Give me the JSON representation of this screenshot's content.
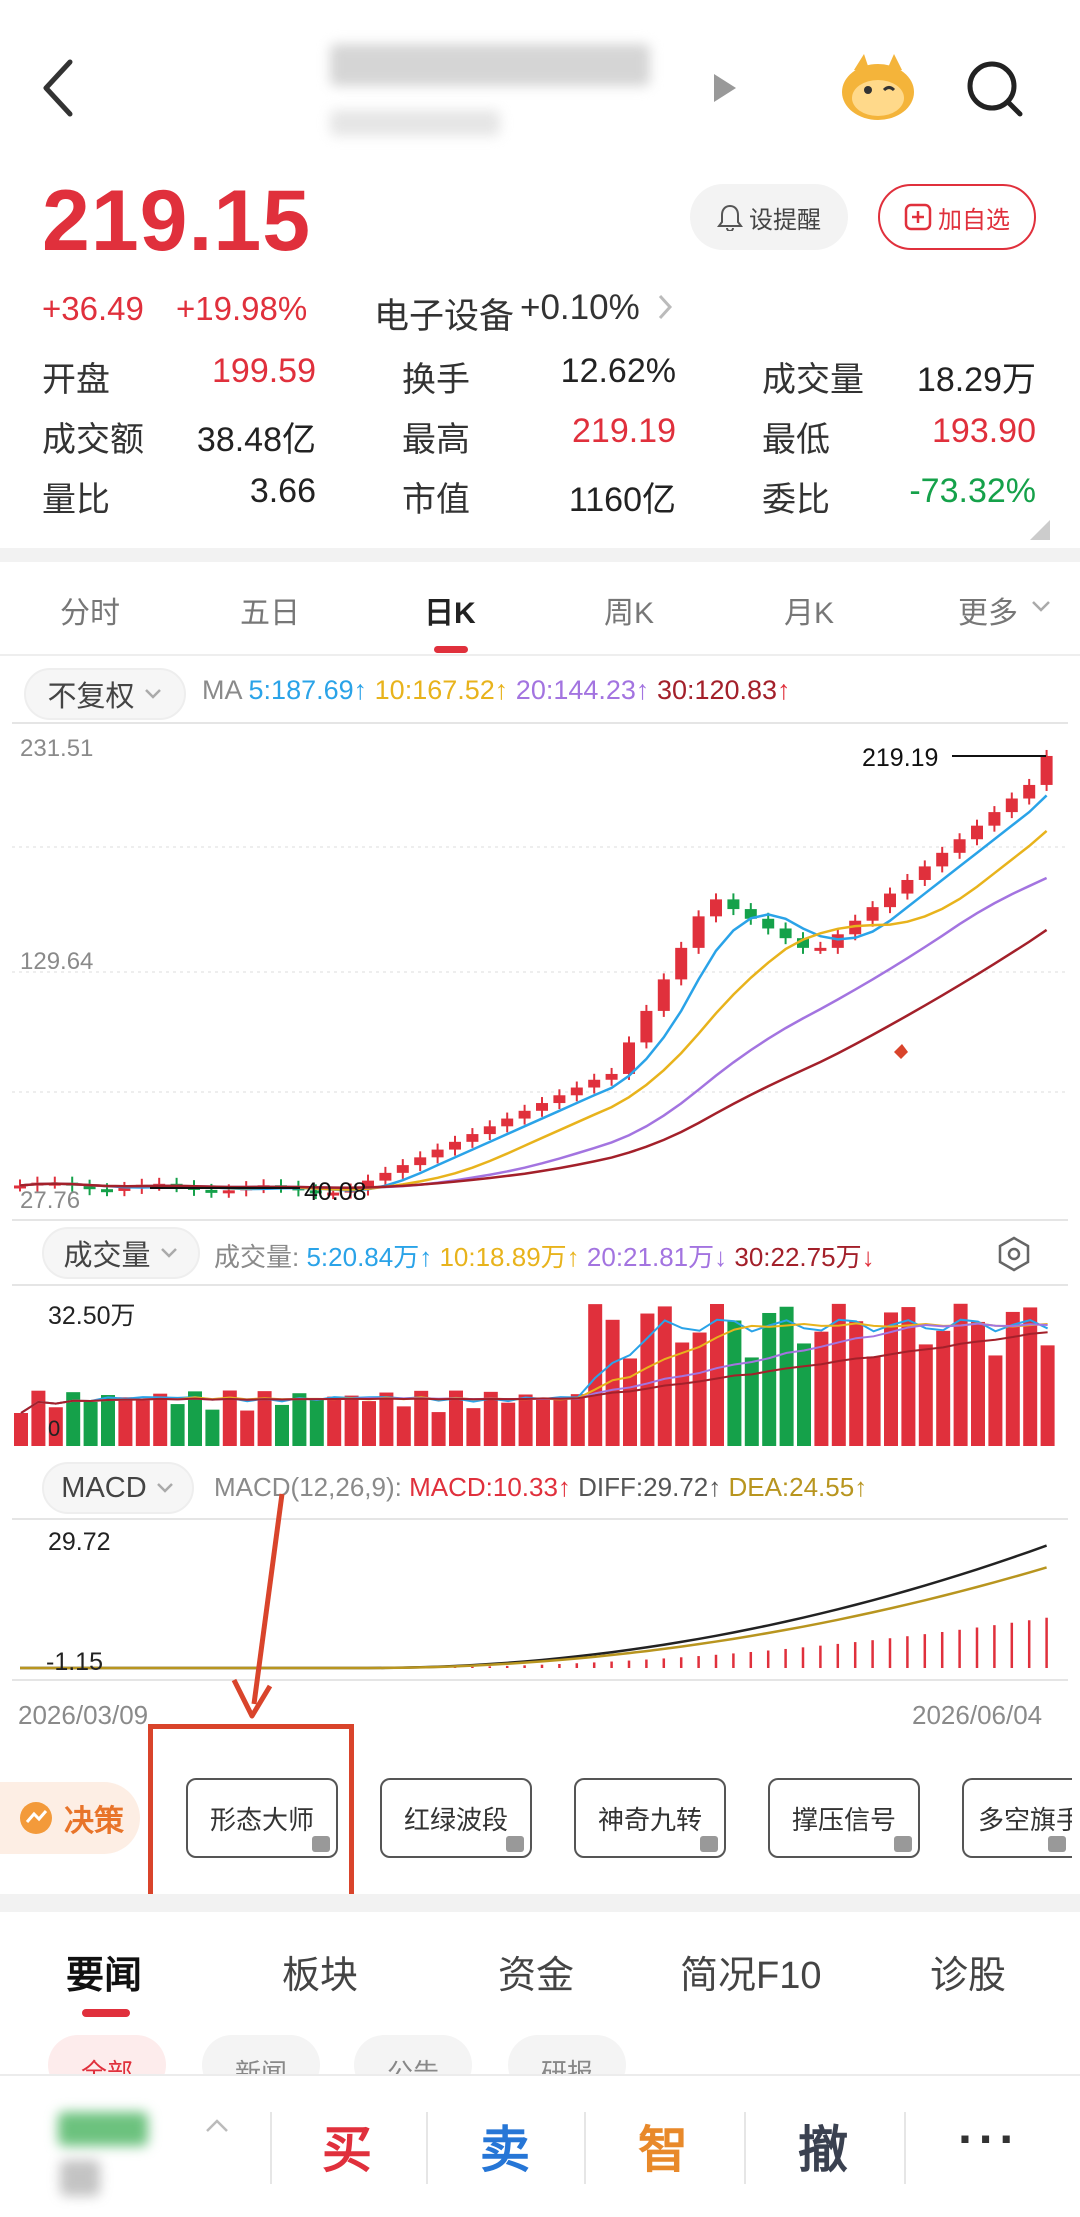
{
  "header": {
    "back_icon": "chevron-left-icon",
    "next_icon": "triangle-right-icon",
    "mascot_icon": "mascot-icon",
    "search_icon": "search-icon"
  },
  "quote": {
    "price": "219.15",
    "change": "+36.49",
    "change_pct": "+19.98%",
    "sector": "电子设备",
    "sector_change": "+0.10%",
    "remind_label": "设提醒",
    "add_watch_label": "加自选",
    "stats": [
      {
        "label": "开盘",
        "value": "199.59",
        "color": "red"
      },
      {
        "label": "换手",
        "value": "12.62%",
        "color": "dark"
      },
      {
        "label": "成交量",
        "value": "18.29万",
        "color": "dark"
      },
      {
        "label": "成交额",
        "value": "38.48亿",
        "color": "dark"
      },
      {
        "label": "最高",
        "value": "219.19",
        "color": "red"
      },
      {
        "label": "最低",
        "value": "193.90",
        "color": "red"
      },
      {
        "label": "量比",
        "value": "3.66",
        "color": "dark"
      },
      {
        "label": "市值",
        "value": "1160亿",
        "color": "dark"
      },
      {
        "label": "委比",
        "value": "-73.32%",
        "color": "green"
      }
    ]
  },
  "ktabs": {
    "items": [
      "分时",
      "五日",
      "日K",
      "周K",
      "月K",
      "更多"
    ],
    "active_index": 2
  },
  "ma_strip": {
    "adjust_label": "不复权",
    "prefix": "MA",
    "ma5": "5:187.69",
    "ma10": "10:167.52",
    "ma20": "20:144.23",
    "ma30": "30:120.83"
  },
  "price_chart": {
    "y_top": "231.51",
    "y_mid": "129.64",
    "y_bottom": "27.76",
    "high_label": "219.19",
    "low_label": "40.08"
  },
  "vol_strip": {
    "label": "成交量",
    "prefix": "成交量:",
    "ma5": "5:20.84万",
    "ma10": "10:18.89万",
    "ma20": "20:21.81万",
    "ma30": "30:22.75万",
    "settings_icon": "hexagon-settings-icon",
    "y_top": "32.50万",
    "y_bottom": "0"
  },
  "macd_strip": {
    "label": "MACD",
    "params": "MACD(12,26,9):",
    "macd": "MACD:10.33",
    "diff": "DIFF:29.72",
    "dea": "DEA:24.55",
    "y_top": "29.72",
    "y_bottom": "-1.15",
    "date_start": "2026/03/09",
    "date_end": "2026/06/04"
  },
  "decision": {
    "label": "决策",
    "buttons": [
      "形态大师",
      "红绿波段",
      "神奇九转",
      "撑压信号",
      "多空旗手"
    ]
  },
  "news_tabs": {
    "items": [
      "要闻",
      "板块",
      "资金",
      "简况F10",
      "诊股"
    ],
    "active_index": 0,
    "sub": [
      "全部",
      "新闻",
      "公告",
      "研报"
    ]
  },
  "bottom_bar": {
    "buy": "买",
    "sell": "卖",
    "smart": "智",
    "cancel": "撤",
    "more": "···"
  },
  "chart_data": {
    "type": "candlestick",
    "x_range": [
      "2026/03/09",
      "2026/06/04"
    ],
    "ylim": [
      27.76,
      231.51
    ],
    "ma_last": {
      "MA5": 187.69,
      "MA10": 167.52,
      "MA20": 144.23,
      "MA30": 120.83
    },
    "high": 219.19,
    "low": 40.08,
    "volume_ylim": [
      0,
      325000
    ],
    "macd": {
      "MACD": 10.33,
      "DIFF": 29.72,
      "DEA": 24.55,
      "ylim": [
        -1.15,
        29.72
      ]
    }
  },
  "colors": {
    "up": "#e0303c",
    "down": "#15a14a",
    "ma5": "#2aa3e8",
    "ma10": "#e8b31c",
    "ma20": "#a374e0",
    "ma30": "#a3202a",
    "annotation": "#d9442b"
  }
}
